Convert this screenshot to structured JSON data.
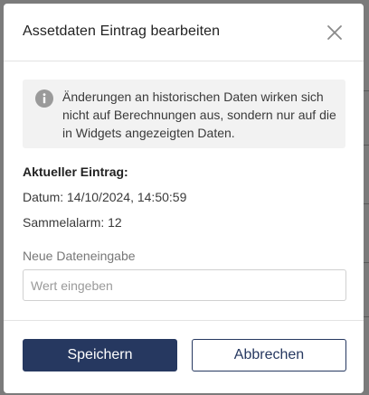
{
  "dialog": {
    "title": "Assetdaten Eintrag bearbeiten",
    "close_icon": "close-icon"
  },
  "info": {
    "icon": "info-icon",
    "text": "Änderungen an historischen Daten wirken sich nicht auf Berechnungen aus, sondern nur auf die in Widgets angezeigten Daten."
  },
  "current_entry": {
    "label": "Aktueller Eintrag:",
    "date_line": "Datum: 14/10/2024, 14:50:59",
    "alarm_line": "Sammelalarm: 12"
  },
  "new_entry": {
    "label": "Neue Dateneingabe",
    "placeholder": "Wert eingeben",
    "value": ""
  },
  "buttons": {
    "save": "Speichern",
    "cancel": "Abbrechen"
  },
  "colors": {
    "primary": "#263860",
    "info_background": "#f2f2f2",
    "overlay": "#7b7b7b"
  }
}
